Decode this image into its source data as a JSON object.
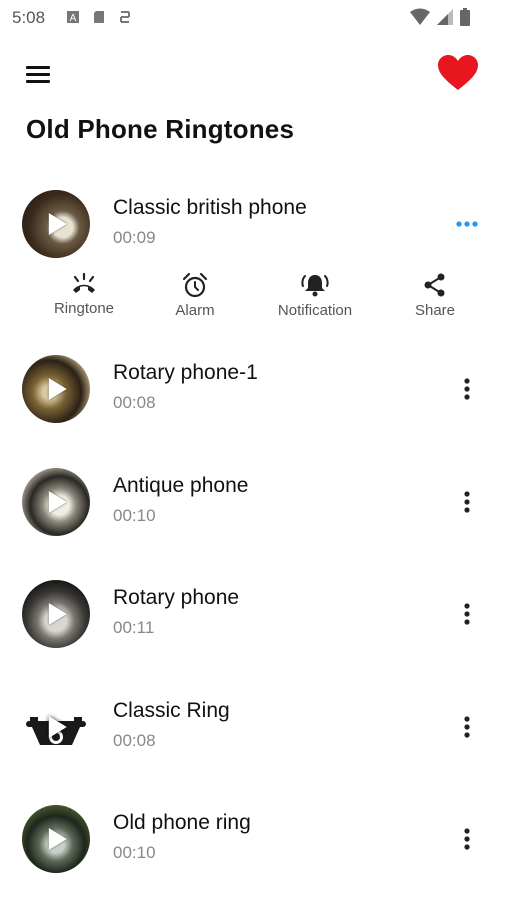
{
  "status": {
    "time": "5:08"
  },
  "header": {
    "title": "Old Phone Ringtones",
    "favorite_color": "#e8161e"
  },
  "expanded_actions": [
    {
      "label": "Ringtone",
      "icon": "phone-ringing-icon"
    },
    {
      "label": "Alarm",
      "icon": "alarm-clock-icon"
    },
    {
      "label": "Notification",
      "icon": "bell-ringing-icon"
    },
    {
      "label": "Share",
      "icon": "share-icon"
    }
  ],
  "tracks": [
    {
      "title": "Classic british phone",
      "duration": "00:09",
      "expanded": true
    },
    {
      "title": "Rotary phone-1",
      "duration": "00:08"
    },
    {
      "title": "Antique phone",
      "duration": "00:10"
    },
    {
      "title": "Rotary phone",
      "duration": "00:11"
    },
    {
      "title": "Classic Ring",
      "duration": "00:08"
    },
    {
      "title": "Old phone ring",
      "duration": "00:10"
    }
  ],
  "accent_color": "#2196f3"
}
